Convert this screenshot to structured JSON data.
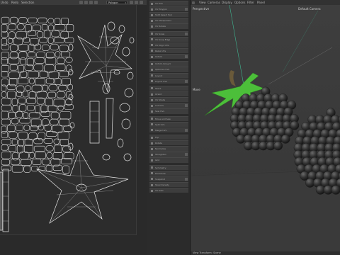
{
  "uv_editor": {
    "menu": [
      "Undo",
      "Redo",
      "Selection",
      "Paint",
      "Redo",
      "Batch",
      "Pinwheel",
      "Relax"
    ],
    "display_select": "Polygon"
  },
  "tools": {
    "items": [
      "UV Pick",
      "UV Polygon",
      "Shift Select Tool",
      "UV Manipulator",
      "UV Rotate",
      "UV Scale",
      "UV Snap Edge",
      "UV Align UVs",
      "Relax UVs",
      "Unfold",
      "Unfold Along V",
      "Optimize UVs",
      "Layout",
      "Layout UVs",
      "Stack",
      "Orient",
      "UV Shells",
      "Cut UVs",
      "Sew UVs",
      "Move and Sew",
      "Split UVs",
      "Merge UVs",
      "Flip",
      "Rotate",
      "Normalize",
      "Straighten",
      "Grid",
      "Symmetry",
      "Distribute",
      "Snapshot",
      "Texel Density",
      "UV Sets"
    ]
  },
  "viewport": {
    "menu": [
      "View",
      "Cameras",
      "Display",
      "Options",
      "Filter",
      "Panel"
    ],
    "mode_label": "Perspective",
    "camera_label": "Default Camera",
    "move_label": "Move",
    "bottom_label": "View Transform: Scene"
  },
  "colors": {
    "leaf": "#4cbf3a",
    "berry": "#3a3a3a",
    "uv_wire": "#e6e6e6",
    "axis_line": "#3fb893"
  }
}
